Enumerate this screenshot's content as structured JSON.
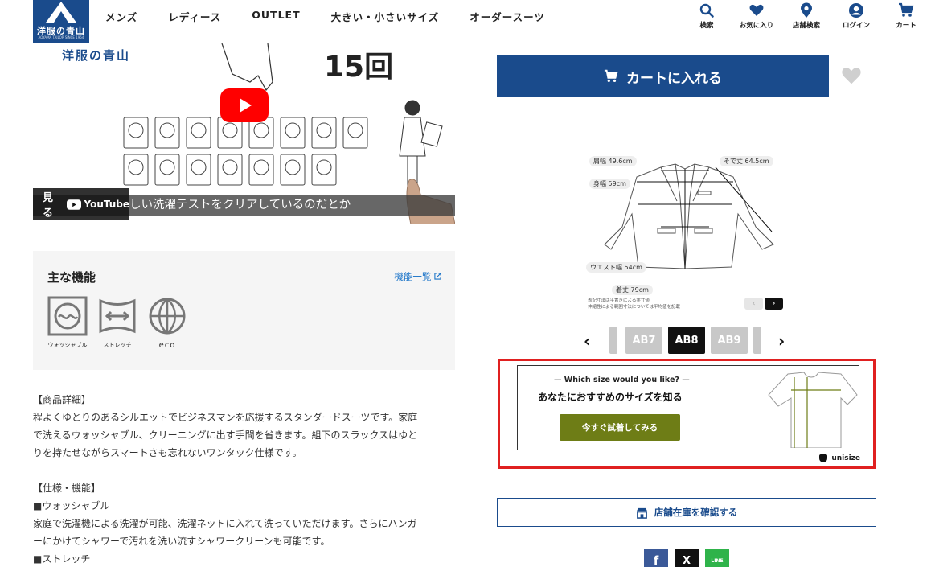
{
  "header": {
    "logo_text": "洋服の青山",
    "logo_sub": "AOYAMA TAILOR SINCE 1964",
    "nav": [
      "メンズ",
      "レディース",
      "OUTLET",
      "大きい・小さいサイズ",
      "オーダースーツ"
    ],
    "icons": [
      {
        "label": "検索",
        "icon": "search-icon"
      },
      {
        "label": "お気に入り",
        "icon": "heart-icon"
      },
      {
        "label": "店舗検索",
        "icon": "map-pin-icon"
      },
      {
        "label": "ログイン",
        "icon": "user-icon"
      },
      {
        "label": "カート",
        "icon": "cart-icon"
      }
    ]
  },
  "video": {
    "brand": "洋服の青山",
    "count_text": "15回",
    "subtitle": "しい洗濯テストをクリアしているのだとか",
    "watch_label": "見る",
    "youtube_label": "YouTube"
  },
  "features": {
    "title": "主な機能",
    "more_link": "機能一覧",
    "items": [
      {
        "label": "ウォッシャブル",
        "icon": "washable-icon"
      },
      {
        "label": "ストレッチ",
        "icon": "stretch-icon"
      },
      {
        "label": "eco",
        "icon": "eco-icon"
      }
    ]
  },
  "description": {
    "heading1": "【商品詳細】",
    "body1": [
      "程よくゆとりのあるシルエットでビジネスマンを応援するスタンダードスーツです。家庭",
      "で洗えるウォッシャブル、クリーニングに出す手間を省きます。組下のスラックスはゆと",
      "りを持たせながらスマートさも忘れないワンタック仕様です。"
    ],
    "heading2": "【仕様・機能】",
    "item1": "■ウォッシャブル",
    "body2": [
      "家庭で洗濯機による洗濯が可能、洗濯ネットに入れて洗っていただけます。さらにハンガ",
      "ーにかけてシャワーで汚れを洗い流すシャワークリーンも可能です。"
    ],
    "item2": "■ストレッチ"
  },
  "cart": {
    "button_label": "カートに入れる",
    "brand_color": "#1a4b8c"
  },
  "measurements": {
    "shoulder": "肩幅 49.6cm",
    "length_sleeve": "そで丈 64.5cm",
    "chest": "身幅 59cm",
    "waist": "ウエスト幅 54cm",
    "length": "着丈 79cm",
    "note": [
      "表記寸法は平置きによる実寸値",
      "伸縮性による範囲寸法については平均値を記載"
    ]
  },
  "sizes": {
    "items": [
      "AB7",
      "AB8",
      "AB9"
    ],
    "selected": "AB8"
  },
  "unisize": {
    "question": "— Which size would you like? —",
    "headline": "あなたにおすすめのサイズを知る",
    "try_button": "今すぐ試着してみる",
    "logo": "unisize"
  },
  "store": {
    "button_label": "店舗在庫を確認する"
  },
  "social": [
    "f",
    "X",
    "LINE"
  ]
}
